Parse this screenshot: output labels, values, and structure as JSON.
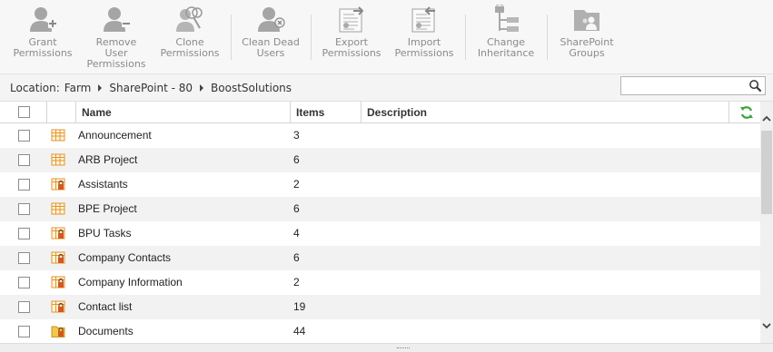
{
  "ribbon": {
    "buttons": [
      {
        "label": "Grant\nPermissions",
        "icon": "user-add-icon"
      },
      {
        "label": "Remove User\nPermissions",
        "icon": "user-remove-icon"
      },
      {
        "label": "Clone\nPermissions",
        "icon": "user-clone-icon"
      },
      {
        "label": "Clean Dead\nUsers",
        "icon": "user-clean-icon"
      },
      {
        "label": "Export\nPermissions",
        "icon": "export-icon"
      },
      {
        "label": "Import\nPermissions",
        "icon": "import-icon"
      },
      {
        "label": "Change\nInheritance",
        "icon": "inheritance-icon"
      },
      {
        "label": "SharePoint\nGroups",
        "icon": "group-folder-icon"
      }
    ]
  },
  "location": {
    "label": "Location:",
    "crumbs": [
      "Farm",
      "SharePoint - 80",
      "BoostSolutions"
    ]
  },
  "search": {
    "value": "",
    "placeholder": ""
  },
  "grid": {
    "headers": {
      "name": "Name",
      "items": "Items",
      "description": "Description"
    },
    "rows": [
      {
        "name": "Announcement",
        "items": "3",
        "icon": "list-icon"
      },
      {
        "name": "ARB Project",
        "items": "6",
        "icon": "list-icon"
      },
      {
        "name": "Assistants",
        "items": "2",
        "icon": "locked-list-icon"
      },
      {
        "name": "BPE Project",
        "items": "6",
        "icon": "list-icon"
      },
      {
        "name": "BPU Tasks",
        "items": "4",
        "icon": "locked-list-icon"
      },
      {
        "name": "Company Contacts",
        "items": "6",
        "icon": "locked-list-icon"
      },
      {
        "name": "Company Information",
        "items": "2",
        "icon": "locked-list-icon"
      },
      {
        "name": "Contact list",
        "items": "19",
        "icon": "locked-list-icon"
      },
      {
        "name": "Documents",
        "items": "44",
        "icon": "locked-library-icon"
      }
    ]
  },
  "colors": {
    "ribbon_icon": "#9a9a9a",
    "list_icon": "#e8a13a",
    "lock": "#c0392b",
    "refresh": "#3aa53a",
    "alt_row": "#f2f2f2"
  }
}
